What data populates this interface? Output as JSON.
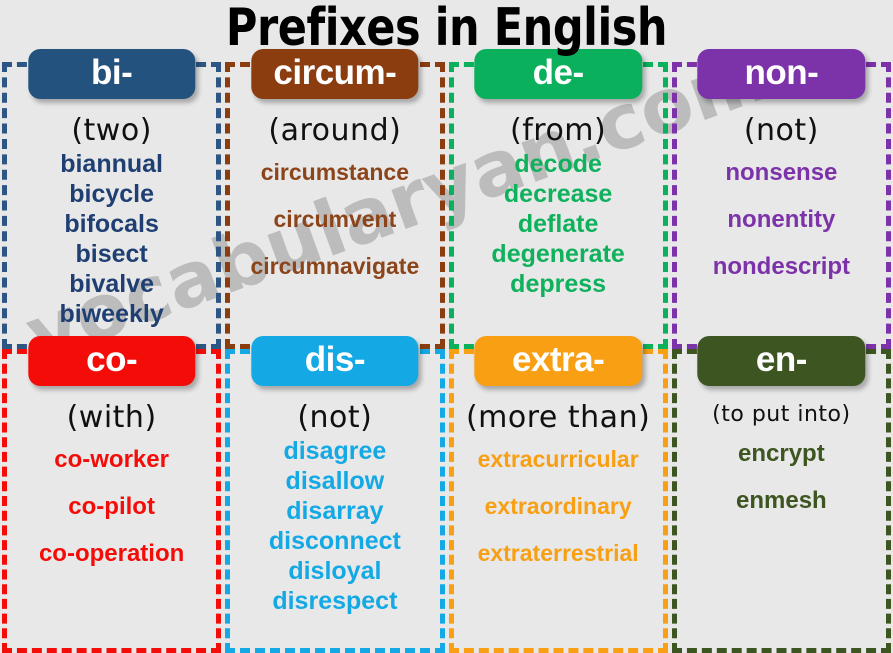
{
  "poster": {
    "title": "Prefixes in English",
    "watermark": "vocabularyan.com",
    "background_color": "#e8e8e8"
  },
  "cards": [
    {
      "prefix": "bi-",
      "meaning": "(two)",
      "color": "#23527e",
      "words": [
        "biannual",
        "bicycle",
        "bifocals",
        "bisect",
        "bivalve",
        "biweekly"
      ]
    },
    {
      "prefix": "circum-",
      "meaning": "(around)",
      "color": "#8c3d0f",
      "words": [
        "circumstance",
        "circumvent",
        "circumnavigate"
      ]
    },
    {
      "prefix": "de-",
      "meaning": "(from)",
      "color": "#0bb05c",
      "words": [
        "decode",
        "decrease",
        "deflate",
        "degenerate",
        "depress"
      ]
    },
    {
      "prefix": "non-",
      "meaning": "(not)",
      "color": "#7c32a8",
      "words": [
        "nonsense",
        "nonentity",
        "nondescript"
      ]
    },
    {
      "prefix": "co-",
      "meaning": "(with)",
      "color": "#f40d08",
      "words": [
        "co-worker",
        "co-pilot",
        "co-operation"
      ]
    },
    {
      "prefix": "dis-",
      "meaning": "(not)",
      "color": "#14a9e4",
      "words": [
        "disagree",
        "disallow",
        "disarray",
        "disconnect",
        "disloyal",
        "disrespect"
      ]
    },
    {
      "prefix": "extra-",
      "meaning": "(more than)",
      "color": "#f89f14",
      "words": [
        "extracurricular",
        "extraordinary",
        "extraterrestrial"
      ]
    },
    {
      "prefix": "en-",
      "meaning": "(to put into)",
      "color": "#3d5520",
      "words": [
        "encrypt",
        "enmesh"
      ]
    }
  ]
}
